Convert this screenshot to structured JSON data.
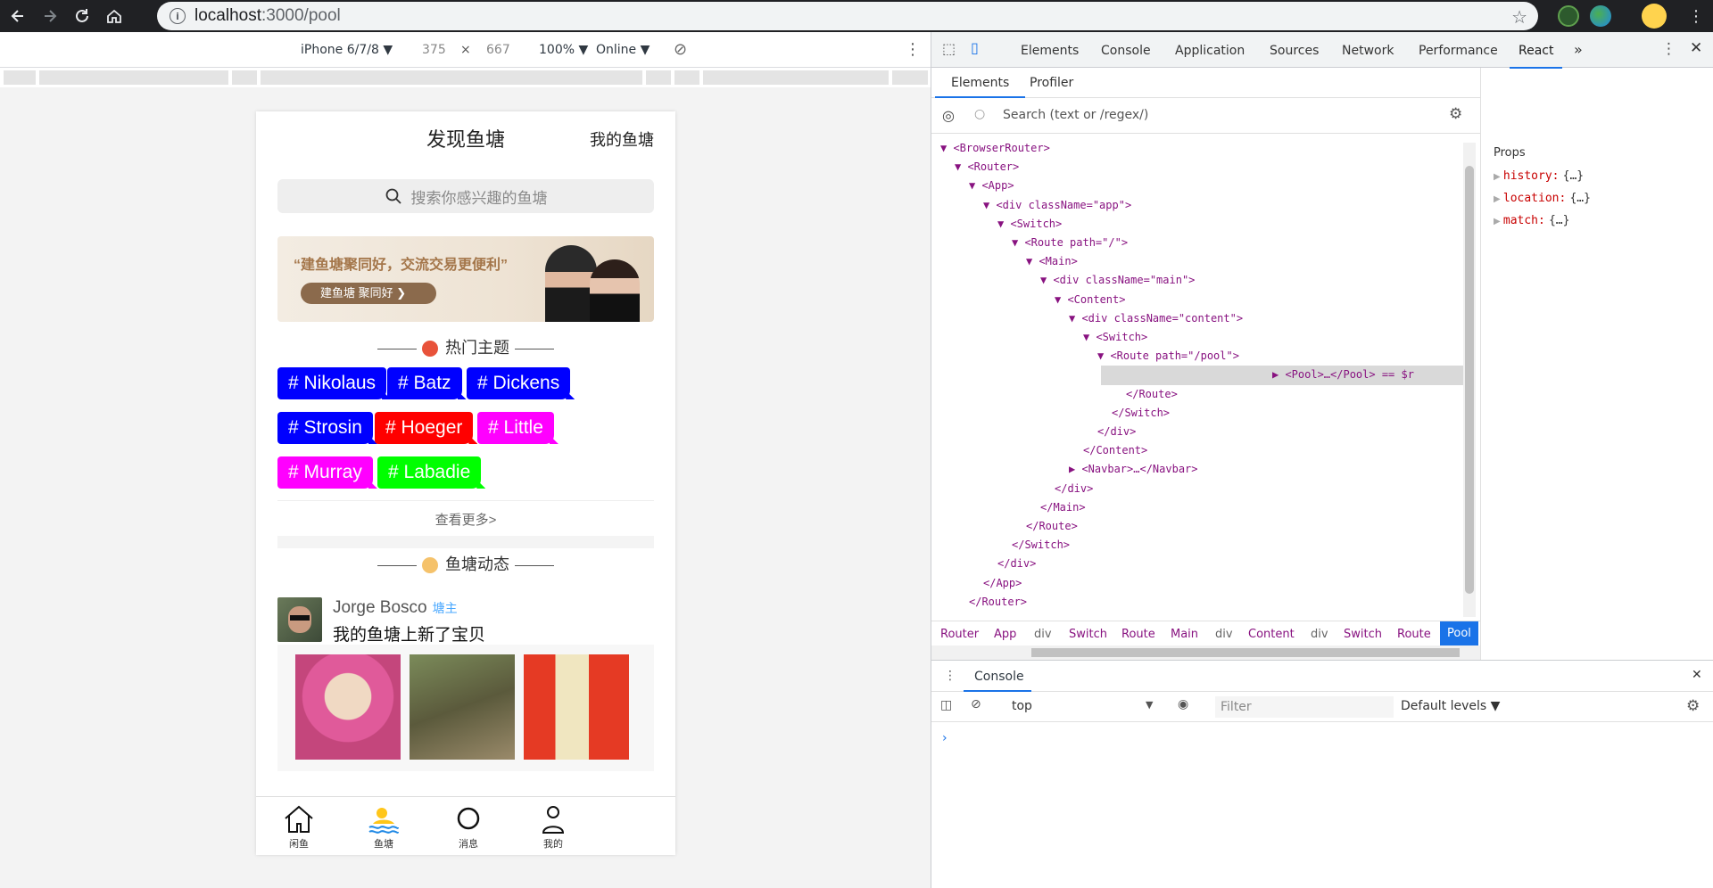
{
  "browser": {
    "url_host": "localhost",
    "url_rest": ":3000/pool"
  },
  "device_toolbar": {
    "device": "iPhone 6/7/8 ▼",
    "width": "375",
    "times": "×",
    "height": "667",
    "zoom": "100% ▼",
    "network": "Online ▼"
  },
  "app": {
    "title": "发现鱼塘",
    "my_pool": "我的鱼塘",
    "search_placeholder": "搜索你感兴趣的鱼塘",
    "banner_text": "“建鱼塘聚同好，交流交易更便利”",
    "banner_button": "建鱼塘 聚同好 ❯",
    "hot_title": "热门主题",
    "tags": [
      {
        "label": "# Nikolaus",
        "color": "#0000ff"
      },
      {
        "label": "# Batz",
        "color": "#0000ff"
      },
      {
        "label": "# Dickens",
        "color": "#0000ff"
      },
      {
        "label": "# Strosin",
        "color": "#0000ff"
      },
      {
        "label": "# Hoeger",
        "color": "#ff0000"
      },
      {
        "label": "# Little",
        "color": "#ff00ff"
      },
      {
        "label": "# Murray",
        "color": "#ff00ff"
      },
      {
        "label": "# Labadie",
        "color": "#00ff00"
      }
    ],
    "more": "查看更多>",
    "feed_title": "鱼塘动态",
    "post": {
      "author": "Jorge Bosco",
      "role": "塘主",
      "text": "我的鱼塘上新了宝贝"
    },
    "tabbar": [
      "闲鱼",
      "鱼塘",
      "消息",
      "我的"
    ]
  },
  "devtools": {
    "tabs": [
      "Elements",
      "Console",
      "Application",
      "Sources",
      "Network",
      "Performance",
      "React"
    ],
    "active_tab": "React",
    "more": "»",
    "sub_tabs": [
      "Elements",
      "Profiler"
    ],
    "search_placeholder": "Search (text or /regex/)",
    "tree": [
      "▼ <BrowserRouter>",
      "▼ <Router>",
      "▼ <App>",
      "▼ <div className=\"app\">",
      "▼ <Switch>",
      "▼ <Route path=\"/\">",
      "▼ <Main>",
      "▼ <div className=\"main\">",
      "▼ <Content>",
      "▼ <div className=\"content\">",
      "▼ <Switch>",
      "▼ <Route path=\"/pool\">",
      "▶ <Pool>…</Pool> == $r",
      "</Route>",
      "</Switch>",
      "</div>",
      "</Content>",
      "▶ <Navbar>…</Navbar>",
      "</div>",
      "</Main>",
      "</Route>",
      "</Switch>",
      "</div>",
      "</App>",
      "</Router>"
    ],
    "crumbs": [
      "Router",
      "App",
      "div",
      "Switch",
      "Route",
      "Main",
      "div",
      "Content",
      "div",
      "Switch",
      "Route",
      "Pool"
    ],
    "props_title": "Props",
    "props": [
      {
        "key": "history:",
        "value": "{…}"
      },
      {
        "key": "location:",
        "value": "{…}"
      },
      {
        "key": "match:",
        "value": "{…}"
      }
    ],
    "console": {
      "title": "Console",
      "context": "top",
      "filter_placeholder": "Filter",
      "levels": "Default levels ▼",
      "prompt": "›"
    }
  }
}
